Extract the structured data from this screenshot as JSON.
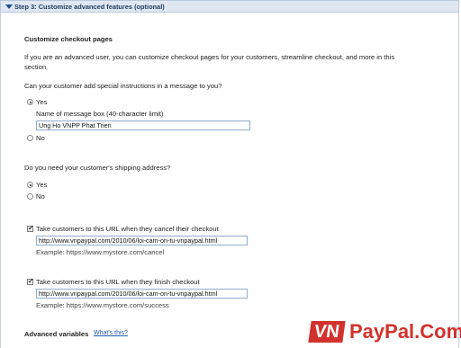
{
  "header": {
    "title": "Step 3: Customize advanced features (optional)"
  },
  "customize": {
    "heading": "Customize checkout pages",
    "intro_line1": "If you are an advanced user, you can customize checkout pages for your customers, streamline checkout, and more in this",
    "intro_line2": "section."
  },
  "special_instructions": {
    "question": "Can your customer add special instructions in a message to you?",
    "yes_label": "Yes",
    "no_label": "No",
    "message_box_label": "Name of message box (40-character limit)",
    "message_box_value": "Ung Ho VNPP Phat Trien"
  },
  "shipping": {
    "question": "Do you need your customer's shipping address?",
    "yes_label": "Yes",
    "no_label": "No"
  },
  "cancel": {
    "label": "Take customers to this URL when they cancel their checkout",
    "url_value": "http://www.vnpaypal.com/2010/06/loi-cam-on-tu-vnpaypal.html",
    "example": "Example: https://www.mystore.com/cancel"
  },
  "finish": {
    "label": "Take customers to this URL when they finish checkout",
    "url_value": "http://www.vnpaypal.com/2010/06/loi-cam-on-tu-vnpaypal.html",
    "example": "Example: https://www.mystore.com/success"
  },
  "advanced": {
    "label": "Advanced variables",
    "link": "What's this?"
  },
  "watermark": {
    "vn": "VN",
    "rest": "PayPal.Com",
    "brand_color": "#d2322d"
  }
}
